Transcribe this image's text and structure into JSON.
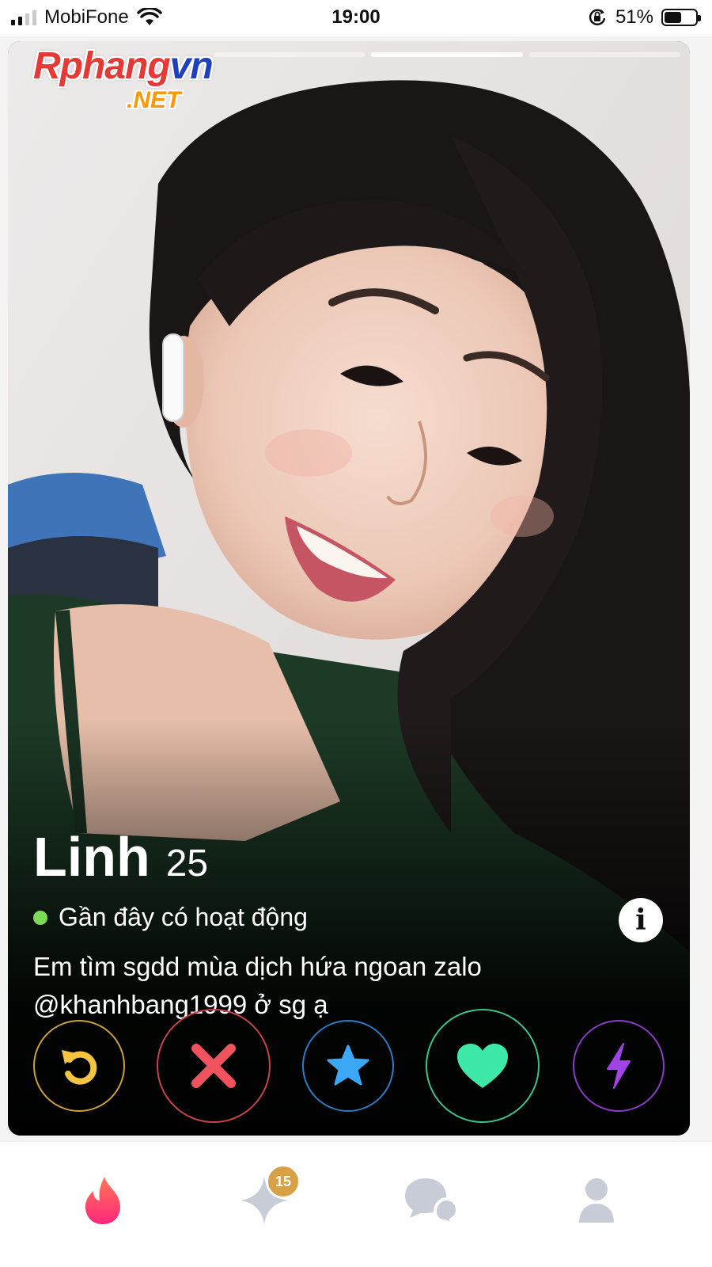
{
  "status_bar": {
    "carrier": "MobiFone",
    "time": "19:00",
    "battery": "51%",
    "battery_level": 0.51,
    "signal_bars": 2,
    "icons": [
      "signal-icon",
      "wifi-icon",
      "orientation-lock-icon",
      "battery-icon"
    ]
  },
  "watermark": {
    "brand_main": "Rphang",
    "brand_accent": "vn",
    "domain": ".NET"
  },
  "profile": {
    "name": "Linh",
    "age": "25",
    "activity": "Gần đây có hoạt động",
    "bio": "Em tìm sgdd mùa dịch hứa ngoan zalo @khanhbang1999 ở sg ạ",
    "photo_count": 3,
    "active_photo_index": 1
  },
  "actions": [
    {
      "name": "rewind",
      "icon": "rewind-icon",
      "color": "#f5c542"
    },
    {
      "name": "nope",
      "icon": "close-x-icon",
      "color": "#f0535d"
    },
    {
      "name": "super-like",
      "icon": "star-icon",
      "color": "#3ba7f5"
    },
    {
      "name": "like",
      "icon": "heart-icon",
      "color": "#3ee8a8"
    },
    {
      "name": "boost",
      "icon": "lightning-icon",
      "color": "#a243e8"
    }
  ],
  "tab_bar": {
    "tabs": [
      {
        "name": "discover",
        "icon": "flame-icon",
        "active": true
      },
      {
        "name": "top-picks",
        "icon": "sparkle-icon",
        "badge": "15"
      },
      {
        "name": "messages",
        "icon": "chat-bubbles-icon"
      },
      {
        "name": "profile",
        "icon": "person-icon"
      }
    ]
  }
}
